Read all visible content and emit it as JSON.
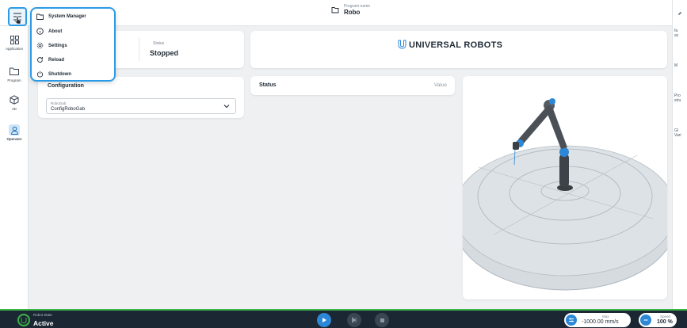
{
  "header": {
    "program_name_label": "Program name",
    "program_name": "Robo"
  },
  "sidebar": {
    "items": [
      {
        "label": "Application",
        "icon": "grid-icon"
      },
      {
        "label": "Program",
        "icon": "folder-icon"
      },
      {
        "label": "3D",
        "icon": "cube-icon"
      },
      {
        "label": "Operator",
        "icon": "person-icon"
      }
    ]
  },
  "menu": {
    "items": [
      {
        "label": "System Manager",
        "icon": "folder-open-icon"
      },
      {
        "label": "About",
        "icon": "info-icon"
      },
      {
        "label": "Settings",
        "icon": "gear-icon"
      },
      {
        "label": "Reload",
        "icon": "reload-icon"
      },
      {
        "label": "Shutdown",
        "icon": "power-icon"
      }
    ]
  },
  "status_panel": {
    "label": "Status",
    "value": "Stopped"
  },
  "brand": {
    "text": "UNIVERSAL ROBOTS"
  },
  "configuration": {
    "title": "Configuration",
    "select_label": "RoboGab",
    "select_value": "ConfigRoboGab"
  },
  "status_table": {
    "col_status": "Status",
    "col_value": "Value"
  },
  "right_edge": {
    "items": [
      "fa",
      "ac",
      "M",
      "Pro",
      "stru",
      "Gl",
      "Vari"
    ]
  },
  "footer": {
    "robot_state_label": "Robot State",
    "robot_state_value": "Active",
    "max_label": "Max",
    "max_value": "-1000.00 mm/s",
    "speed_label": "Speed",
    "speed_value": "100 %"
  },
  "colors": {
    "accent": "#2c9be6",
    "active_green": "#3bb54a",
    "footer_bg": "#1b2733",
    "robot_joint_blue": "#2c87d6"
  }
}
